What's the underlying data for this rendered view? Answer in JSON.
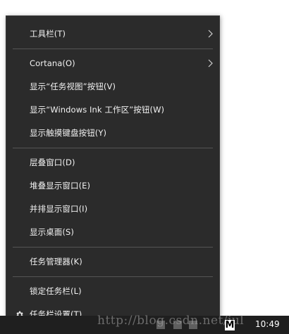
{
  "context_menu": {
    "items": [
      {
        "label": "工具栏(T)"
      },
      {
        "label": "Cortana(O)"
      },
      {
        "label": "显示“任务视图”按钮(V)"
      },
      {
        "label": "显示“Windows Ink 工作区”按钮(W)"
      },
      {
        "label": "显示触摸键盘按钮(Y)"
      },
      {
        "label": "层叠窗口(D)"
      },
      {
        "label": "堆叠显示窗口(E)"
      },
      {
        "label": "并排显示窗口(I)"
      },
      {
        "label": "显示桌面(S)"
      },
      {
        "label": "任务管理器(K)"
      },
      {
        "label": "锁定任务栏(L)"
      },
      {
        "label": "任务栏设置(T)"
      }
    ]
  },
  "taskbar": {
    "clock_time": "10:49",
    "ime_indicator": "M"
  },
  "watermark": {
    "text": "http://blog.csdn.net/jul"
  },
  "colors": {
    "menu_background": "#2b2b2b",
    "menu_text": "#f2f2f2",
    "separator": "#555555",
    "taskbar": "#1f1f1f"
  },
  "icons": {
    "submenu_arrow": "chevron-right-icon",
    "settings": "gear-icon"
  }
}
